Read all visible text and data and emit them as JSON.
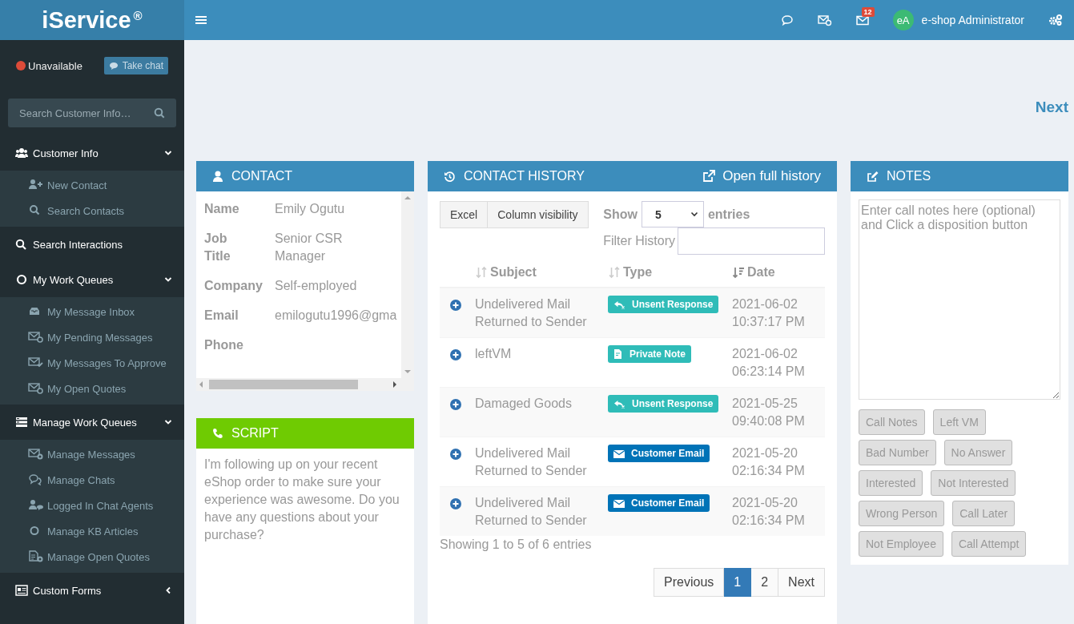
{
  "sidebar": {
    "brand": "iService",
    "brand_mark": "®",
    "status": {
      "label": "Unavailable",
      "color": "#dd4b39"
    },
    "take_chat": "Take chat",
    "search": {
      "placeholder": "Search Customer Info…"
    },
    "menu": [
      {
        "label": "Customer Info",
        "expanded": true,
        "children": [
          {
            "label": "New Contact"
          },
          {
            "label": "Search Contacts"
          }
        ]
      },
      {
        "label": "Search Interactions"
      },
      {
        "label": "My Work Queues",
        "expanded": true,
        "children": [
          {
            "label": "My Message Inbox"
          },
          {
            "label": "My Pending Messages"
          },
          {
            "label": "My Messages To Approve"
          },
          {
            "label": "My Open Quotes"
          }
        ]
      },
      {
        "label": "Manage Work Queues",
        "expanded": true,
        "children": [
          {
            "label": "Manage Messages"
          },
          {
            "label": "Manage Chats"
          },
          {
            "label": "Logged In Chat Agents"
          },
          {
            "label": "Manage KB Articles"
          },
          {
            "label": "Manage Open Quotes"
          }
        ]
      },
      {
        "label": "Custom Forms",
        "expanded": false
      }
    ]
  },
  "topbar": {
    "mail_badge": "12",
    "avatar": "eA",
    "user": "e-shop Administrator"
  },
  "next_link": "Next",
  "contact": {
    "title": "CONTACT",
    "fields": [
      {
        "label": "Name",
        "value": "Emily Ogutu"
      },
      {
        "label": "Job Title",
        "value": "Senior CSR Manager"
      },
      {
        "label": "Company",
        "value": "Self-employed"
      },
      {
        "label": "Email",
        "value": "emilogutu1996@gma"
      },
      {
        "label": "Phone"
      }
    ]
  },
  "script": {
    "title": "SCRIPT",
    "text": "I'm following up on your recent eShop order to make sure your experience was awesome. Do you have any questions about your purchase?"
  },
  "history": {
    "title": "CONTACT HISTORY",
    "open_full": "Open full history",
    "buttons": [
      "Excel",
      "Column visibility"
    ],
    "show_label": "Show",
    "page_size": "5",
    "entries_label": "entries",
    "filter_label": "Filter History",
    "columns": [
      "Subject",
      "Type",
      "Date"
    ],
    "rows": [
      {
        "subject": "Undelivered Mail Returned to Sender",
        "type": {
          "label": "Unsent Response",
          "kind": "unsent",
          "color": "#2fbcb8"
        },
        "date": "2021-06-02 10:37:17 PM"
      },
      {
        "subject": "leftVM",
        "type": {
          "label": "Private Note",
          "kind": "note",
          "color": "#2fbcb8"
        },
        "date": "2021-06-02 06:23:14 PM"
      },
      {
        "subject": "Damaged Goods",
        "type": {
          "label": "Unsent Response",
          "kind": "unsent",
          "color": "#2fbcb8"
        },
        "date": "2021-05-25 09:40:08 PM"
      },
      {
        "subject": "Undelivered Mail Returned to Sender",
        "type": {
          "label": "Customer Email",
          "kind": "email",
          "color": "#0073b7"
        },
        "date": "2021-05-20 02:16:34 PM"
      },
      {
        "subject": "Undelivered Mail Returned to Sender",
        "type": {
          "label": "Customer Email",
          "kind": "email",
          "color": "#0073b7"
        },
        "date": "2021-05-20 02:16:34 PM"
      }
    ],
    "info": "Showing 1 to 5 of 6 entries",
    "pages": [
      {
        "label": "Previous",
        "selected": false
      },
      {
        "label": "1",
        "selected": true
      },
      {
        "label": "2",
        "selected": false
      },
      {
        "label": "Next",
        "selected": false
      }
    ]
  },
  "notes": {
    "title": "NOTES",
    "placeholder": "Enter call notes here (optional) and Click a disposition button",
    "buttons": [
      "Call Notes",
      "Left VM",
      "Bad Number",
      "No Answer",
      "Interested",
      "Not Interested",
      "Wrong Person",
      "Call Later",
      "Not Employee",
      "Call Attempt"
    ]
  }
}
